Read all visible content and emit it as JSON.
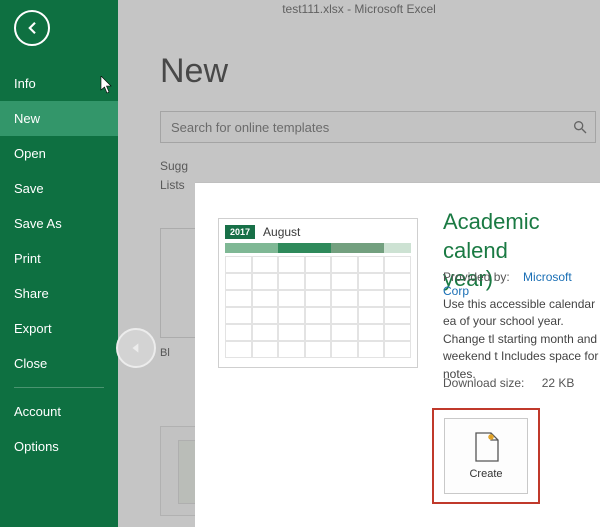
{
  "titlebar": "test111.xlsx - Microsoft Excel",
  "sidebar": {
    "items": [
      {
        "label": "Info"
      },
      {
        "label": "New"
      },
      {
        "label": "Open"
      },
      {
        "label": "Save"
      },
      {
        "label": "Save As"
      },
      {
        "label": "Print"
      },
      {
        "label": "Share"
      },
      {
        "label": "Export"
      },
      {
        "label": "Close"
      }
    ],
    "footer": [
      {
        "label": "Account"
      },
      {
        "label": "Options"
      }
    ]
  },
  "main": {
    "heading": "New",
    "search_placeholder": "Search for online templates",
    "suggested_prefix": "Sugg",
    "suggested_line2": "Lists",
    "thumb1_label": "Bl"
  },
  "template": {
    "title": "Academic calendar (any year)",
    "title_visible": "Academic calend year)",
    "title_line1": "Academic calend",
    "title_line2": "year)",
    "provided_label": "Provided by:",
    "provider": "Microsoft Corp",
    "description": "Use this accessible calendar ea of your school year. Change tl starting month and weekend t Includes space for notes.",
    "download_label": "Download size:",
    "download_value": "22 KB",
    "create_label": "Create",
    "preview": {
      "year": "2017",
      "month": "August"
    }
  }
}
